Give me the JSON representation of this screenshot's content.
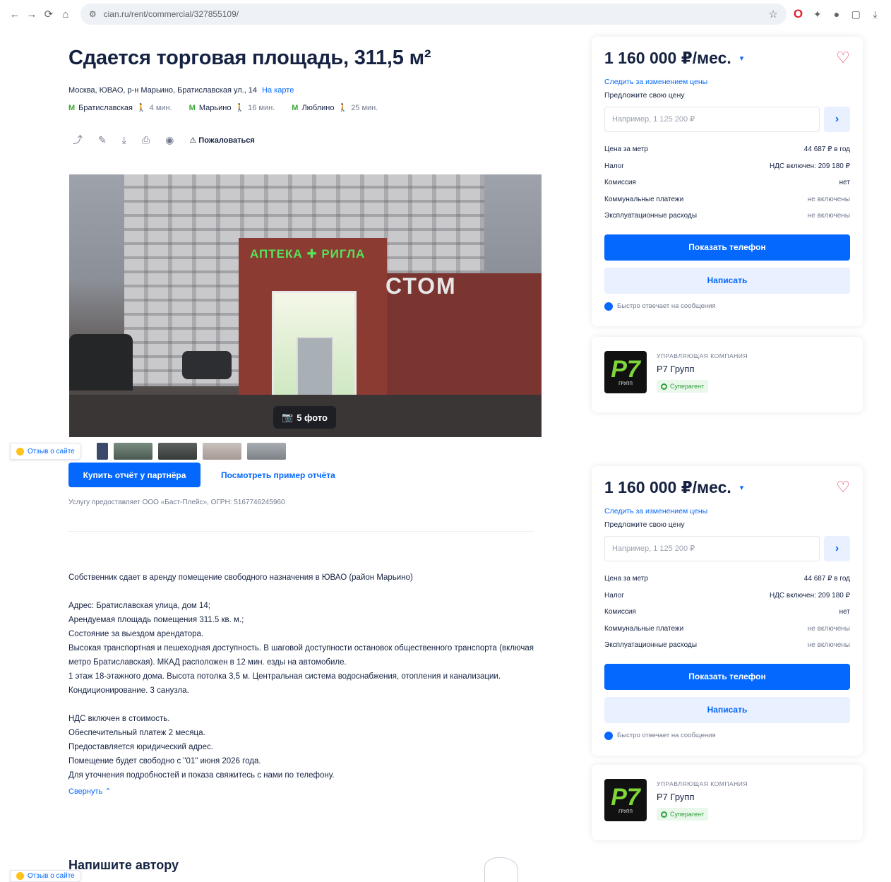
{
  "browser": {
    "url": "cian.ru/rent/commercial/327855109/",
    "icons": [
      "back-icon",
      "forward-icon",
      "reload-icon",
      "home-icon",
      "bookmark-star-icon",
      "opera-icon",
      "extension-icon",
      "profile-icon",
      "downloads-icon"
    ]
  },
  "listing": {
    "title": "Сдается торговая площадь, 311,5 м²",
    "address": "Москва, ЮВАО, р-н Марьино, Братиславская ул., 14",
    "map_link": "На карте",
    "metros": [
      {
        "name": "Братиславская",
        "walk": "4 мин."
      },
      {
        "name": "Марьино",
        "walk": "16 мин."
      },
      {
        "name": "Люблино",
        "walk": "25 мин."
      }
    ],
    "complain": "Пожаловаться",
    "photo_count": "5 фото",
    "photo_sign": "АПТЕКА ✚ РИГЛА",
    "photo_sign2": "СТОМ",
    "feedback": "Отзыв о сайте",
    "partner_button": "Купить отчёт у партнёра",
    "example_link": "Посмотреть пример отчёта",
    "provider": "Услугу предоставляет ООО «Баст-Плейс», ОГРН: 5167746245960",
    "description": [
      "Собственник сдает в аренду помещение свободного назначения в ЮВАО (район Марьино)",
      "Адрес: Братиславская улица, дом 14;\nАрендуемая площадь помещения 311.5 кв. м.;\nСостояние за выездом арендатора.\nВысокая транспортная и пешеходная доступность. В шаговой доступности остановок общественного транспорта (включая метро Братиславская). МКАД расположен в 12 мин. езды на автомобиле.\n1 этаж 18-этажного дома. Высота потолка 3,5 м. Центральная система водоснабжения, отопления и канализации. Кондиционирование. 3 санузла.",
      "НДС включен в стоимость.\nОбеспечительный платеж 2 месяца.\nПредоставляется юридический адрес.\nПомещение будет свободно с \"01\" июня 2026 года.\nДля уточнения подробностей и показа свяжитесь с нами по телефону."
    ],
    "collapse": "Свернуть",
    "write_author": "Напишите автору"
  },
  "price_card": {
    "price": "1 160 000 ₽/мес.",
    "follow": "Следить за изменением цены",
    "offer_label": "Предложите свою цену",
    "offer_placeholder": "Например, 1 125 200 ₽",
    "params": [
      {
        "label": "Цена за метр",
        "value": "44 687 ₽ в год"
      },
      {
        "label": "Налог",
        "value": "НДС включен: 209 180 ₽"
      },
      {
        "label": "Комиссия",
        "value": "нет"
      },
      {
        "label": "Коммунальные платежи",
        "value": "не включены"
      },
      {
        "label": "Эксплуатационные расходы",
        "value": "не включены"
      }
    ],
    "phone_button": "Показать телефон",
    "write_button": "Написать",
    "fast_reply": "Быстро отвечает на сообщения"
  },
  "agent": {
    "type": "Управляющая компания",
    "name": "Р7 Групп",
    "badge": "Суперагент",
    "logo_big": "Р7",
    "logo_small": "ГРУПП"
  },
  "colors": {
    "accent": "#0468ff",
    "heart": "#e84260",
    "metro": "#3aaa35",
    "badge": "#2e9e3a"
  }
}
